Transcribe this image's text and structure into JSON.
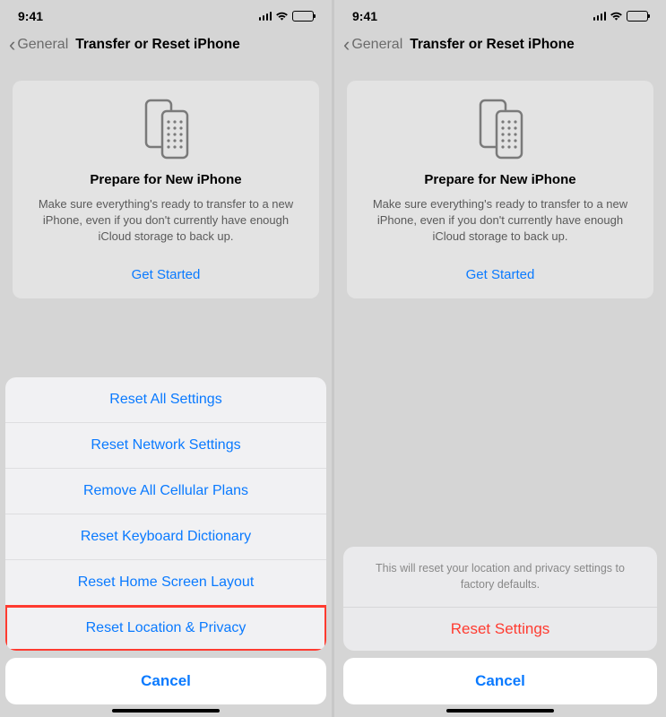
{
  "statusBar": {
    "time": "9:41"
  },
  "nav": {
    "backLabel": "General",
    "title": "Transfer or Reset iPhone"
  },
  "card": {
    "title": "Prepare for New iPhone",
    "description": "Make sure everything's ready to transfer to a new iPhone, even if you don't currently have enough iCloud storage to back up.",
    "cta": "Get Started"
  },
  "sheet": {
    "items": [
      "Reset All Settings",
      "Reset Network Settings",
      "Remove All Cellular Plans",
      "Reset Keyboard Dictionary",
      "Reset Home Screen Layout",
      "Reset Location & Privacy"
    ],
    "cancel": "Cancel"
  },
  "alert": {
    "message": "This will reset your location and privacy settings to factory defaults.",
    "action": "Reset Settings",
    "cancel": "Cancel"
  }
}
